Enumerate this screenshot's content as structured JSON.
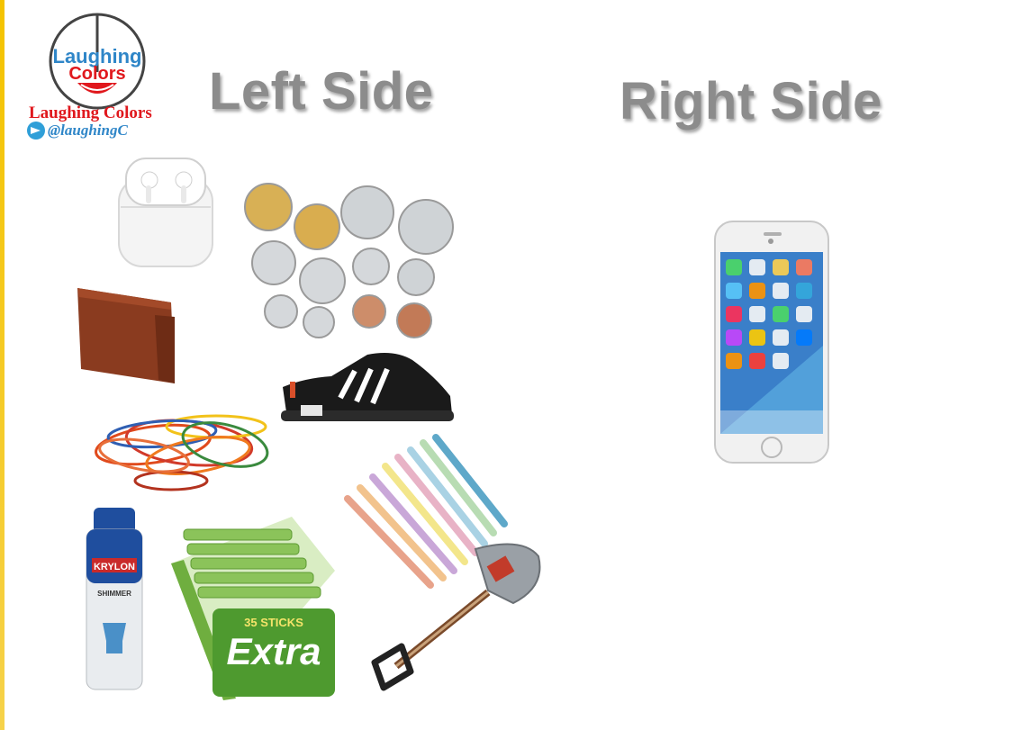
{
  "logo": {
    "word_top": "Laughing",
    "word_bottom": "Colors",
    "name": "Laughing Colors",
    "handle": "@laughingC",
    "colors": {
      "red": "#e0181d",
      "blue": "#2f86c8",
      "yellow": "#f4c300"
    }
  },
  "headings": {
    "left": "Left Side",
    "right": "Right Side"
  },
  "left_items": {
    "earbuds": "airpods-case",
    "coins": "coins",
    "wallet": "wallet",
    "sneaker": "sneaker",
    "rubber_bands": "rubber-bands",
    "spray_can": {
      "brand": "KRYLON",
      "label": "SHIMMER"
    },
    "gum_box": {
      "brand": "Extra",
      "count": "35 STICKS"
    },
    "pencils": "colored-pencils",
    "shovel": "shovel"
  },
  "right_items": {
    "phone": "smartphone"
  }
}
